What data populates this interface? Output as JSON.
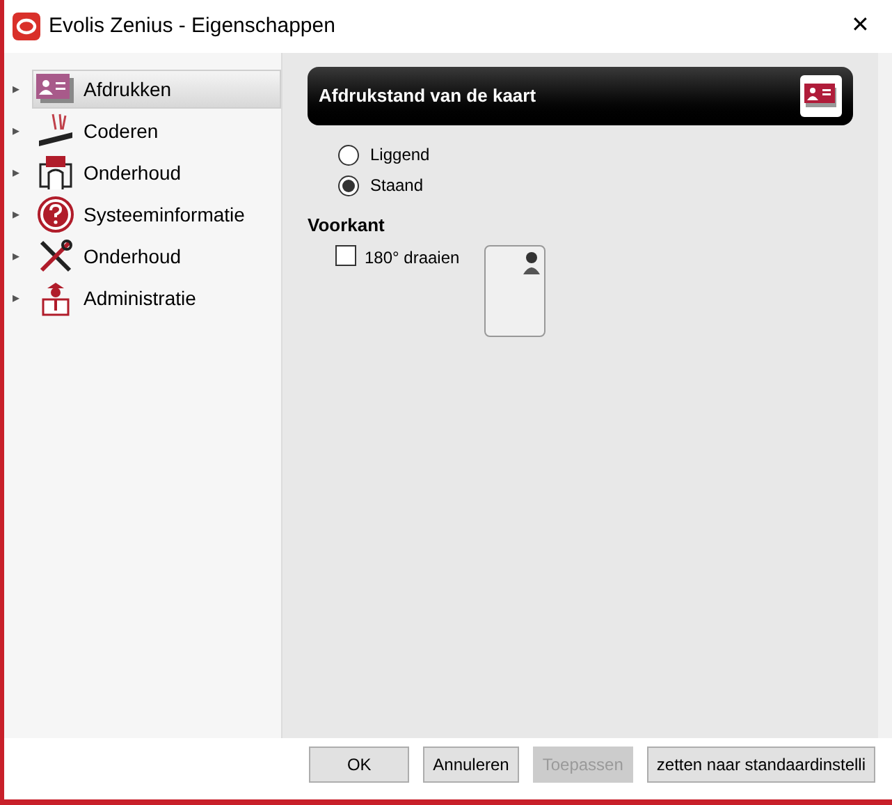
{
  "window": {
    "title": "Evolis Zenius - Eigenschappen",
    "close": "✕"
  },
  "sidebar": {
    "items": [
      {
        "label": "Afdrukken",
        "selected": true,
        "expander": "▸"
      },
      {
        "label": "Coderen",
        "selected": false,
        "expander": "▸"
      },
      {
        "label": "Onderhoud",
        "selected": false,
        "expander": "▸"
      },
      {
        "label": "Systeeminformatie",
        "selected": false,
        "expander": "▸"
      },
      {
        "label": "Onderhoud",
        "selected": false,
        "expander": "▸"
      },
      {
        "label": "Administratie",
        "selected": false,
        "expander": "▸"
      }
    ]
  },
  "panel": {
    "title": "Afdrukstand van de kaart",
    "orientation": [
      {
        "label": "Liggend",
        "selected": false
      },
      {
        "label": "Staand",
        "selected": true
      }
    ],
    "section": "Voorkant",
    "rotate": {
      "label": "180° draaien",
      "checked": false
    }
  },
  "buttons": [
    {
      "label": "OK",
      "disabled": false
    },
    {
      "label": "Annuleren",
      "disabled": false
    },
    {
      "label": "Toepassen",
      "disabled": true
    },
    {
      "label": "zetten naar standaardinstelli",
      "disabled": false
    }
  ]
}
